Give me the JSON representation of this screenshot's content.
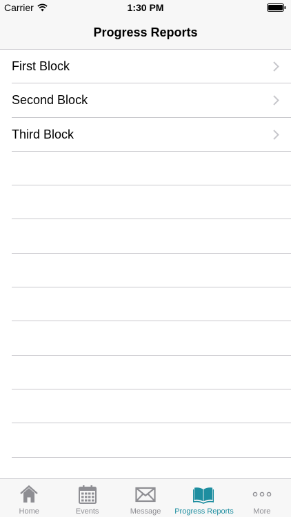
{
  "status_bar": {
    "carrier": "Carrier",
    "time": "1:30 PM"
  },
  "nav": {
    "title": "Progress Reports"
  },
  "rows": [
    {
      "label": "First Block"
    },
    {
      "label": "Second Block"
    },
    {
      "label": "Third Block"
    }
  ],
  "tabs": [
    {
      "label": "Home",
      "icon": "home-icon"
    },
    {
      "label": "Events",
      "icon": "calendar-icon"
    },
    {
      "label": "Message",
      "icon": "envelope-icon"
    },
    {
      "label": "Progress Reports",
      "icon": "open-book-icon",
      "active": true
    },
    {
      "label": "More",
      "icon": "more-dots-icon"
    }
  ],
  "colors": {
    "accent": "#1e8ea0",
    "inactive": "#8e8e93",
    "bar_background": "#f7f7f7",
    "separator": "#c8c7cc"
  }
}
